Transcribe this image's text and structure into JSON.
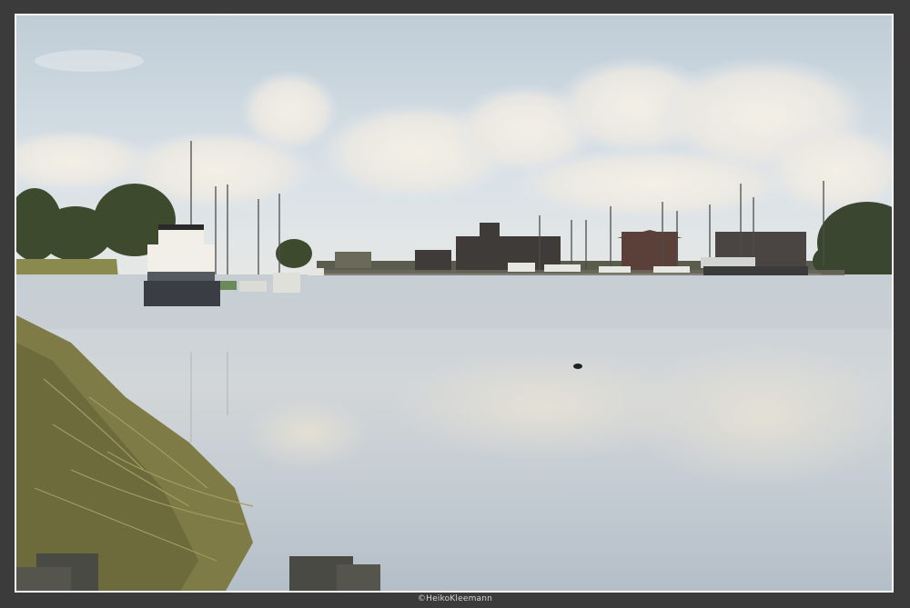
{
  "photo": {
    "credit": "©HeikoKleemann"
  },
  "colors": {
    "frame": "#3b3b3b",
    "border": "#f4f4f4",
    "sky_top": "#bccbd6",
    "sky_low": "#dfe5ea",
    "water_top": "#cdd4da",
    "water_bottom": "#b7c0c9",
    "reeds": "#8d8a4c",
    "buildings": "#3f3b38"
  }
}
